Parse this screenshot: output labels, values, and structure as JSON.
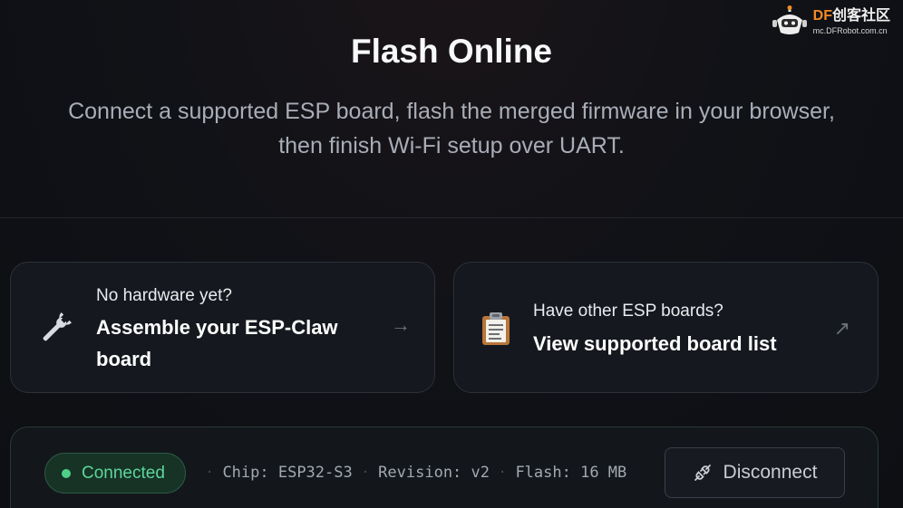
{
  "watermark": {
    "brand_df": "DF",
    "brand_rest": "创客社区",
    "url": "mc.DFRobot.com.cn",
    "icon": "robot-logo-icon"
  },
  "hero": {
    "title": "Flash Online",
    "subtitle": "Connect a supported ESP board, flash the merged firmware in your browser, then finish Wi-Fi setup over UART."
  },
  "cards": [
    {
      "kicker": "No hardware yet?",
      "heading": "Assemble your ESP-Claw board",
      "icon": "wrench-icon",
      "arrow": "→"
    },
    {
      "kicker": "Have other ESP boards?",
      "heading": "View supported board list",
      "icon": "clipboard-icon",
      "arrow": "↗"
    }
  ],
  "status": {
    "state_label": "Connected",
    "state_color": "#4fd08a",
    "chip": "Chip: ESP32-S3",
    "revision": "Revision: v2",
    "flash": "Flash: 16 MB",
    "separator": "·",
    "disconnect_label": "Disconnect",
    "disconnect_icon": "plug-icon"
  }
}
